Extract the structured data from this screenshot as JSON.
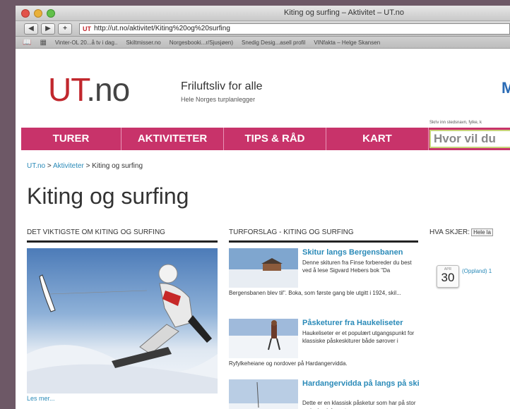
{
  "browser": {
    "window_title": "Kiting og surfing – Aktivitet – UT.no",
    "address_prefix": "UT",
    "address_url": "http://ut.no/aktivitet/Kiting%20og%20surfing",
    "back_label": "◀",
    "forward_label": "▶",
    "add_label": "+",
    "bookmarks": [
      "Vinter-OL 20...å tv i dag..",
      "Skiltmisser.no",
      "Norgesbooki...r/Sjusjøen)",
      "Snedig Desig...asell profil",
      "VINfakta – Helge Skansen"
    ]
  },
  "site": {
    "logo_main": "UT",
    "logo_suffix": ".no",
    "tagline": "Friluftsliv for alle",
    "subtagline": "Hele Norges turplanlegger",
    "right_logo": "M",
    "search_hint": "Skriv inn stedsnavn, fylke, k",
    "search_placeholder": "Hvor vil du"
  },
  "nav": {
    "turer": "TURER",
    "aktiviteter": "AKTIVITETER",
    "tips": "TIPS & RÅD",
    "kart": "KART"
  },
  "breadcrumb": {
    "home": "UT.no",
    "sep1": " > ",
    "section": "Aktiviteter",
    "sep2": " > ",
    "current": "Kiting og surfing"
  },
  "page_title": "Kiting og surfing",
  "columns": {
    "left_heading": "DET VIKTIGSTE OM KITING OG SURFING",
    "middle_heading": "TURFORSLAG - KITING OG SURFING",
    "right_heading": "HVA SKJER:",
    "right_select": "Hele la"
  },
  "hero": {
    "read_more": "Les mer..."
  },
  "articles": [
    {
      "title": "Skitur langs Bergensbanen",
      "text_right": "Denne skituren fra Finse forbereder du best ved å lese Sigvard Hebers bok \"Da",
      "text_full": "Bergensbanen blev til\". Boka, som første gang ble utgitt i 1924, skil..."
    },
    {
      "title": "Påsketurer fra Haukeliseter",
      "text_right": "Haukeliseter er et populært utgangspunkt for klassiske påskeskiturer både sørover i",
      "text_full": "Ryfylkeheiane og nordover på Hardangervidda."
    },
    {
      "title": "Hardangervidda på langs på ski",
      "text_right": "Dette er en klassisk påsketur som har på stor variasjon i dagsetapper"
    }
  ],
  "event": {
    "month": "APR",
    "day": "30",
    "text": "(Oppland) 1"
  }
}
